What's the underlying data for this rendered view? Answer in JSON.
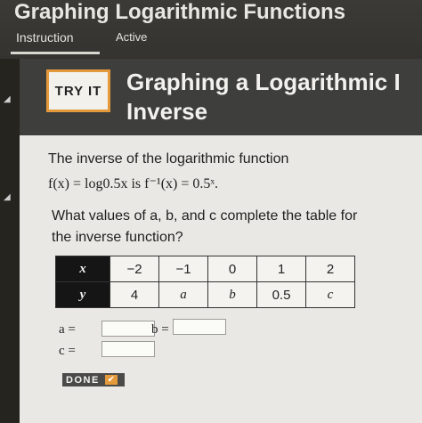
{
  "header": {
    "app_title": "Graphing Logarithmic Functions",
    "tabs": [
      {
        "label": "Instruction"
      },
      {
        "label": "Active"
      }
    ]
  },
  "banner": {
    "badge": "TRY IT",
    "title_line1": "Graphing a Logarithmic I",
    "title_line2": "Inverse"
  },
  "problem": {
    "intro": "The inverse of the logarithmic function",
    "formula": "f(x) = log0.5x is f⁻¹(x) = 0.5ˣ.",
    "question_line1": "What values of a, b, and c complete the table for",
    "question_line2": "the inverse function?"
  },
  "table": {
    "row_x": {
      "header": "x",
      "cells": [
        "−2",
        "−1",
        "0",
        "1",
        "2"
      ]
    },
    "row_y": {
      "header": "y",
      "cells": [
        "4",
        "a",
        "b",
        "0.5",
        "c"
      ]
    }
  },
  "answers": {
    "a_label": "a =",
    "b_label": "b =",
    "c_label": "c =",
    "a_value": "",
    "b_value": "",
    "c_value": ""
  },
  "done_button": {
    "label": "DONE",
    "icon": "check-icon"
  },
  "colors": {
    "accent": "#e49a3a",
    "panel": "#e9e8e4",
    "banner": "#3e3e3c"
  }
}
